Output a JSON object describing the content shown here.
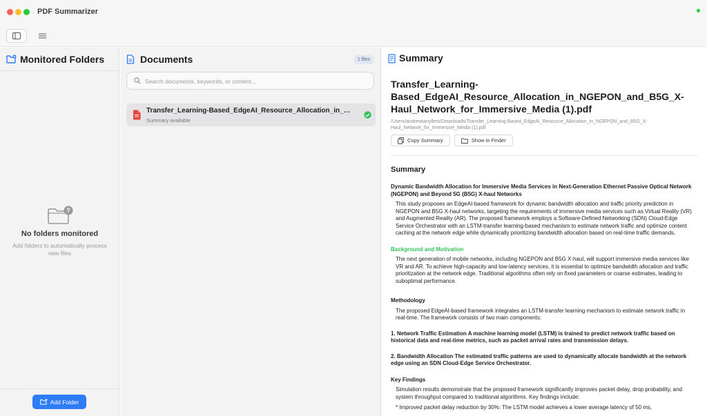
{
  "app": {
    "title": "PDF Summarizer"
  },
  "left": {
    "title": "Monitored Folders",
    "empty_title": "No folders monitored",
    "empty_sub": "Add folders to automatically process new files",
    "add_button": "Add Folder"
  },
  "middle": {
    "title": "Documents",
    "badge": "1 files",
    "search_placeholder": "Search documents, keywords, or content...",
    "documents": [
      {
        "name": "Transfer_Learning-Based_EdgeAI_Resource_Allocation_in_NGEPON_and_B5G_X-Haul_Network_for_Immersive_Media (1).pdf",
        "status": "Summary available"
      }
    ]
  },
  "right": {
    "title": "Summary",
    "pdf_title": "Transfer_Learning-Based_EdgeAI_Resource_Allocation_in_NGEPON_and_B5G_X-Haul_Network_for_Immersive_Media (1).pdf",
    "pdf_path": "/Users/andrewtanyllem/Downloads/Transfer_Learning-Based_EdgeAI_Resource_Allocation_in_NGEPON_and_B5G_X-Haul_Network_for_Immersive_Media (1).pdf",
    "copy_button": "Copy Summary",
    "finder_button": "Show in Finder",
    "summary_heading": "Summary",
    "main_title": "Dynamic Bandwidth Allocation for Immersive Media Services in Next-Generation Ethernet Passive Optical Network (NGEPON) and Beyond 5G (B5G) X-haul Networks",
    "intro": "This study proposes an EdgeAI-based framework for dynamic bandwidth allocation and traffic priority prediction in NGEPON and B5G X-haul networks, targeting the requirements of immersive media services such as Virtual Reality (VR) and Augmented Reality (AR). The proposed framework employs a Software-Defined Networking (SDN) Cloud-Edge Service Orchestrator with an LSTM-transfer learning-based mechanism to estimate network traffic and optimize content caching at the network edge while dynamically prioritizing bandwidth allocation based on real-time traffic demands.",
    "bg_title": "Background and Motivation",
    "bg_text": "The next generation of mobile networks, including NGEPON and B5G X-haul, will support immersive media services like VR and AR. To achieve high-capacity and low-latency services, it is essential to optimize bandwidth allocation and traffic prioritization at the network edge. Traditional algorithms often rely on fixed parameters or coarse estimates, leading to suboptimal performance.",
    "method_title": "Methodology",
    "method_text": "The proposed EdgeAI-based framework integrates an LSTM-transfer learning mechanism to estimate network traffic in real-time. The framework consists of two main components:",
    "item1": "1. Network Traffic Estimation A machine learning model (LSTM) is trained to predict network traffic based on historical data and real-time metrics, such as packet arrival rates and transmission delays.",
    "item2": "2. Bandwidth Allocation The estimated traffic patterns are used to dynamically allocate bandwidth at the network edge using an SDN Cloud-Edge Service Orchestrator.",
    "findings_title": "Key Findings",
    "findings_text": "Simulation results demonstrate that the proposed framework significantly improves packet delay, drop probability, and system throughput compared to traditional algorithms. Key findings include:",
    "bullet1": "* Improved packet delay reduction by 30%: The LSTM model achieves a lower average latency of 50 ms,"
  },
  "colors": {
    "accent": "#2f7df6",
    "success": "#34c05b",
    "pdf_red": "#e5453c"
  }
}
